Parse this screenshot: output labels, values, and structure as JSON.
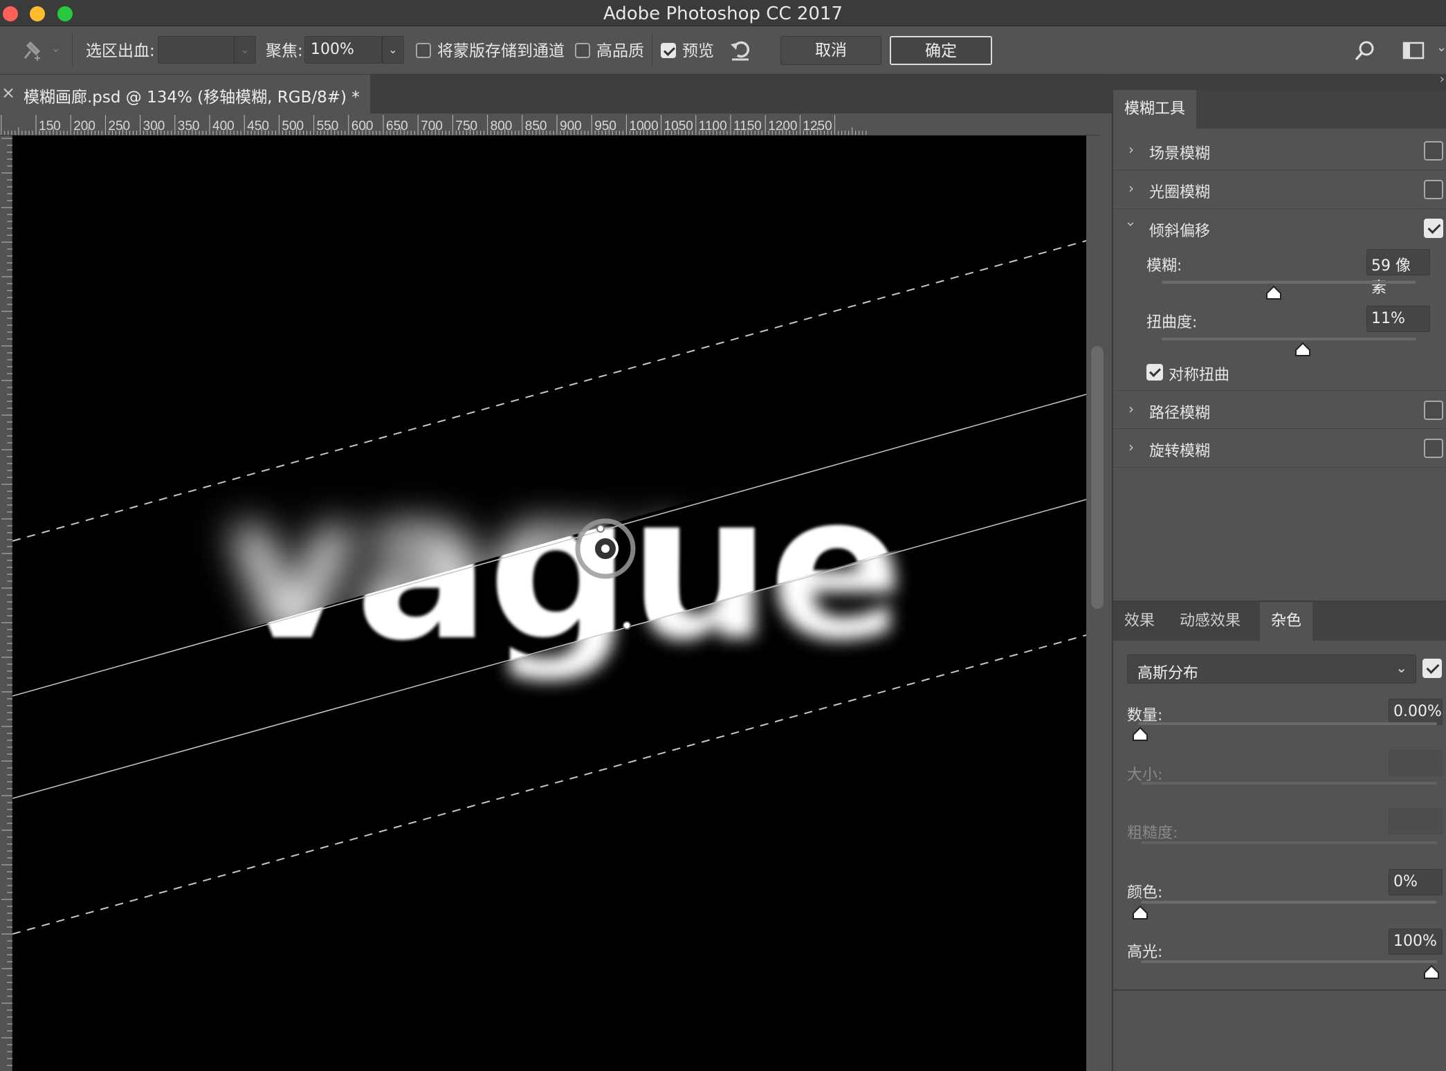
{
  "app": {
    "title": "Adobe Photoshop CC 2017"
  },
  "options": {
    "selection_bleed_label": "选区出血:",
    "selection_bleed_value": "",
    "focus_label": "聚焦:",
    "focus_value": "100%",
    "save_mask_label": "将蒙版存储到通道",
    "save_mask_checked": false,
    "high_quality_label": "高品质",
    "high_quality_checked": false,
    "preview_label": "预览",
    "preview_checked": true,
    "cancel_label": "取消",
    "ok_label": "确定"
  },
  "document": {
    "tab_title": "模糊画廊.psd @ 134% (移轴模糊, RGB/8#) *",
    "canvas_text": "vague"
  },
  "ruler": {
    "labels": [
      "150",
      "200",
      "250",
      "300",
      "350",
      "400",
      "450",
      "500",
      "550",
      "600",
      "650",
      "700",
      "750",
      "800",
      "850",
      "900",
      "950",
      "1000",
      "1050",
      "1100",
      "1150",
      "1200",
      "1250"
    ]
  },
  "blur_tools": {
    "panel_tab": "模糊工具",
    "items": [
      {
        "label": "场景模糊",
        "checked": false,
        "expanded": false
      },
      {
        "label": "光圈模糊",
        "checked": false,
        "expanded": false
      },
      {
        "label": "倾斜偏移",
        "checked": true,
        "expanded": true
      },
      {
        "label": "路径模糊",
        "checked": false,
        "expanded": false
      },
      {
        "label": "旋转模糊",
        "checked": false,
        "expanded": false
      }
    ],
    "tilt_shift": {
      "blur_label": "模糊:",
      "blur_value": "59 像素",
      "blur_level": 0.44,
      "distortion_label": "扭曲度:",
      "distortion_value": "11%",
      "distortion_level": 0.555,
      "symmetric_label": "对称扭曲",
      "symmetric_checked": true
    }
  },
  "effects": {
    "tabs": [
      "效果",
      "动感效果",
      "杂色"
    ],
    "active_tab": "杂色",
    "noise": {
      "distribution_value": "高斯分布",
      "enabled": true,
      "amount_label": "数量:",
      "amount_value": "0.00%",
      "size_label": "大小:",
      "size_value": "",
      "roughness_label": "粗糙度:",
      "roughness_value": "",
      "color_label": "颜色:",
      "color_value": "0%",
      "highlight_label": "高光:",
      "highlight_value": "100%"
    }
  }
}
